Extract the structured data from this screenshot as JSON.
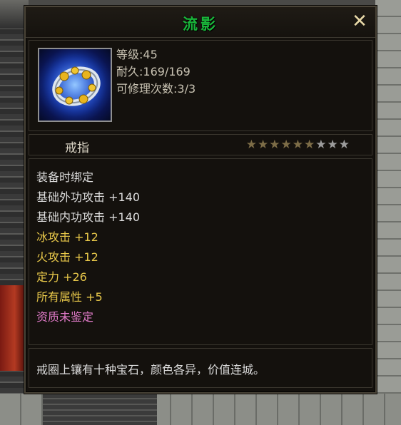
{
  "item": {
    "name": "流影",
    "close_glyph": "✕",
    "icon": "ring-icon",
    "stats": {
      "level": "等级:45",
      "durability": "耐久:169/169",
      "repairs": "可修理次数:3/3"
    },
    "type": "戒指",
    "stars": {
      "filled": 6,
      "total": 9
    },
    "attributes": [
      {
        "text": "装备时绑定",
        "color": "#dcdcdc"
      },
      {
        "text": "基础外功攻击  +140",
        "color": "#dcdcdc"
      },
      {
        "text": "基础内功攻击  +140",
        "color": "#dcdcdc"
      },
      {
        "text": "冰攻击  +12",
        "color": "#e8c84a"
      },
      {
        "text": "火攻击  +12",
        "color": "#e8c84a"
      },
      {
        "text": "定力  +26",
        "color": "#e8c84a"
      },
      {
        "text": "所有属性  +5",
        "color": "#e8c84a"
      },
      {
        "text": "资质未鉴定",
        "color": "#e07ac8"
      }
    ],
    "description": "戒圈上镶有十种宝石，颜色各异，价值连城。"
  },
  "colors": {
    "title_green": "#19b53a",
    "attr_white": "#dcdcdc",
    "attr_gold": "#e8c84a",
    "attr_pink": "#e07ac8"
  }
}
